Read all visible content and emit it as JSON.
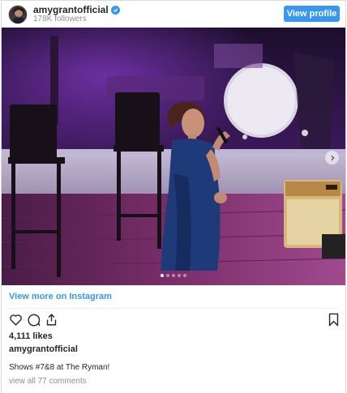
{
  "header": {
    "username": "amygrantofficial",
    "verified": true,
    "followers": "178K followers",
    "view_profile_label": "View profile"
  },
  "post": {
    "photo_description_icon": "concert-photo",
    "carousel": {
      "slide_count": 5,
      "active_index": 0
    },
    "view_more_label": "View more on Instagram",
    "likes": "4,111 likes",
    "owner": "amygrantofficial",
    "caption": "Shows #7&8 at The Ryman!",
    "comments_link": "view all 77 comments"
  },
  "colors": {
    "accent": "#3897f0",
    "text": "#262626",
    "muted": "#8e8e8e",
    "stage_purple": "#6a2a8f"
  },
  "icons": {
    "like": "heart-icon",
    "comment": "comment-icon",
    "share": "share-icon",
    "save": "bookmark-icon",
    "verified": "verified-badge-icon",
    "next": "chevron-right-icon"
  }
}
